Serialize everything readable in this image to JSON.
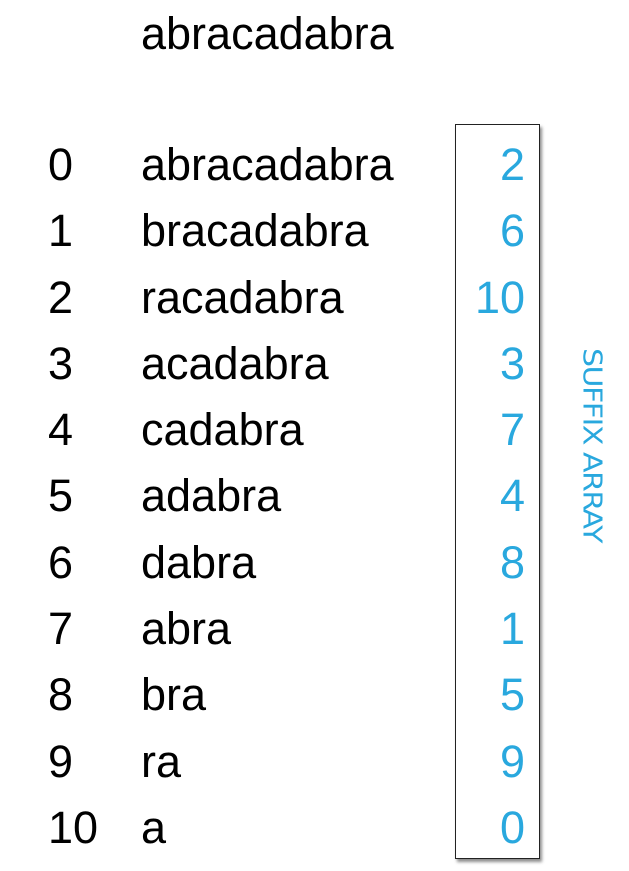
{
  "title": "abracadabra",
  "rows": [
    {
      "index": "0",
      "suffix": "abracadabra",
      "sa": "2"
    },
    {
      "index": "1",
      "suffix": "bracadabra",
      "sa": "6"
    },
    {
      "index": "2",
      "suffix": "racadabra",
      "sa": "10"
    },
    {
      "index": "3",
      "suffix": "acadabra",
      "sa": "3"
    },
    {
      "index": "4",
      "suffix": "cadabra",
      "sa": "7"
    },
    {
      "index": "5",
      "suffix": "adabra",
      "sa": "4"
    },
    {
      "index": "6",
      "suffix": "dabra",
      "sa": "8"
    },
    {
      "index": "7",
      "suffix": "abra",
      "sa": "1"
    },
    {
      "index": "8",
      "suffix": "bra",
      "sa": "5"
    },
    {
      "index": "9",
      "suffix": "ra",
      "sa": "9"
    },
    {
      "index": "10",
      "suffix": "a",
      "sa": "0"
    }
  ],
  "array_label": "SUFFIX ARRAY",
  "colors": {
    "accent": "#29a8de",
    "text": "#000000",
    "box_border": "#222222"
  }
}
